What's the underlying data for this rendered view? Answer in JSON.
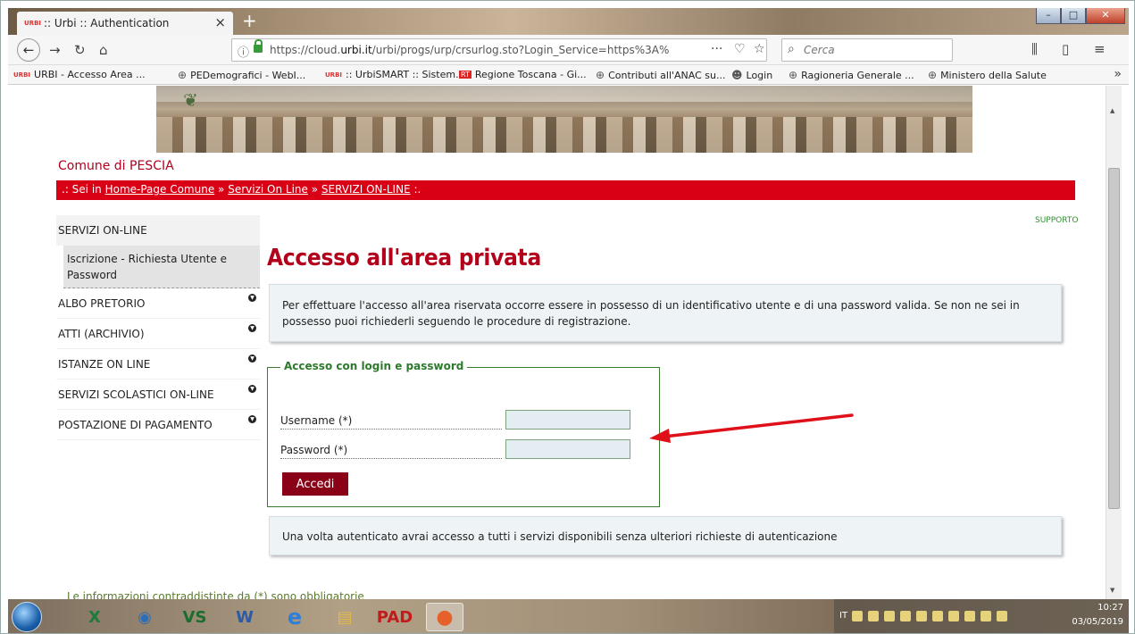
{
  "browser": {
    "tab_title": ":: Urbi :: Authentication",
    "tab_favicon": "urbi",
    "tab_close": "×",
    "new_tab": "+",
    "url_prefix": "https://cloud.",
    "url_domain": "urbi.it",
    "url_suffix": "/urbi/progs/urp/crsurlog.sto?Login_Service=https%3A%",
    "search_placeholder": "Cerca",
    "bookmarks": [
      {
        "label": "URBI - Accesso Area ...",
        "icon": "urbi"
      },
      {
        "label": "PEDemografici - WebI...",
        "icon": "globe"
      },
      {
        "label": ":: UrbiSMART :: Sistem...",
        "icon": "urbi"
      },
      {
        "label": "Regione Toscana - Gi...",
        "icon": "rt"
      },
      {
        "label": "Contributi all'ANAC su...",
        "icon": "globe"
      },
      {
        "label": "Login",
        "icon": "user"
      },
      {
        "label": "Ragioneria Generale ...",
        "icon": "globe"
      },
      {
        "label": "Ministero della Salute",
        "icon": "globe"
      }
    ],
    "bookmark_more": "»"
  },
  "page": {
    "municipality": "Comune di PESCIA",
    "breadcrumb_prefix": ".: Sei in ",
    "breadcrumb_links": [
      "Home-Page Comune",
      "Servizi On Line",
      "SERVIZI ON-LINE"
    ],
    "breadcrumb_sep": " » ",
    "breadcrumb_suffix": " :.",
    "support_link": "SUPPORTO",
    "menu": {
      "header": "SERVIZI ON-LINE",
      "subitem": "Iscrizione - Richiesta Utente e Password",
      "items": [
        "ALBO PRETORIO",
        "ATTI (ARCHIVIO)",
        "ISTANZE ON LINE",
        "SERVIZI SCOLASTICI ON-LINE",
        "POSTAZIONE DI PAGAMENTO"
      ]
    },
    "title": "Accesso all'area privata",
    "info_text": "Per effettuare l'accesso all'area riservata occorre essere in possesso di un identificativo utente e di una password valida. Se non ne sei in possesso puoi richiederli seguendo le procedure di registrazione.",
    "login_legend": "Accesso con login e password",
    "username_label": "Username (*)",
    "username_value": "",
    "password_label": "Password (*)",
    "password_value": "",
    "submit_label": "Accedi",
    "after_login_text": "Una volta autenticato avrai accesso a tutti i servizi disponibili senza ulteriori richieste di autenticazione",
    "required_note": "Le informazioni contraddistinte da (*) sono obbligatorie"
  },
  "taskbar": {
    "apps": [
      {
        "name": "excel",
        "label": "X",
        "color": "#1d7a3b"
      },
      {
        "name": "thunderbird",
        "label": "◉",
        "color": "#2d6fb5"
      },
      {
        "name": "vs",
        "label": "VS",
        "color": "#1c6d2f"
      },
      {
        "name": "word",
        "label": "W",
        "color": "#2a5ba8"
      },
      {
        "name": "ie",
        "label": "e",
        "color": "#2f7fd9"
      },
      {
        "name": "explorer",
        "label": "▤",
        "color": "#e2b84a"
      },
      {
        "name": "pad",
        "label": "PAD",
        "color": "#c21b1b"
      },
      {
        "name": "firefox",
        "label": "●",
        "color": "#e6602a"
      }
    ],
    "language": "IT",
    "time": "10:27",
    "date": "03/05/2019"
  },
  "colors": {
    "brand_red": "#d90016",
    "title_red": "#b3001b",
    "green_accent": "#2d7a2d",
    "arrow_red": "#e0101a"
  }
}
